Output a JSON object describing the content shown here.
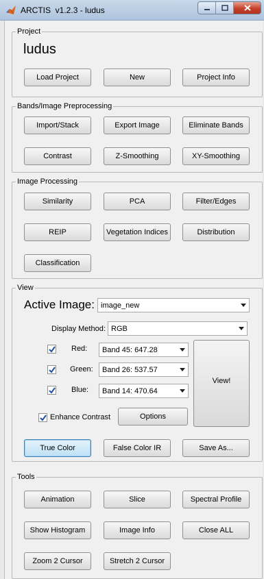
{
  "window": {
    "title": "ARCTIS  v1.2.3 - ludus",
    "controls": [
      "minimize",
      "maximize",
      "close"
    ]
  },
  "project": {
    "group_title": "Project",
    "name": "ludus",
    "buttons": [
      "Load Project",
      "New",
      "Project Info"
    ]
  },
  "bands": {
    "group_title": "Bands/Image Preprocessing",
    "buttons": [
      "Import/Stack",
      "Export Image",
      "Eliminate Bands",
      "Contrast",
      "Z-Smoothing",
      "XY-Smoothing"
    ]
  },
  "image_processing": {
    "group_title": "Image Processing",
    "buttons": [
      "Similarity",
      "PCA",
      "Filter/Edges",
      "REIP",
      "Vegetation Indices",
      "Distribution",
      "Classification"
    ]
  },
  "view": {
    "group_title": "View",
    "active_image_label": "Active Image:",
    "active_image_value": "image_new",
    "display_method_label": "Display Method:",
    "display_method_value": "RGB",
    "channels": [
      {
        "label": "Red:",
        "checked": true,
        "value": "Band 45: 647.28"
      },
      {
        "label": "Green:",
        "checked": true,
        "value": "Band 26: 537.57"
      },
      {
        "label": "Blue:",
        "checked": true,
        "value": "Band 14: 470.64"
      }
    ],
    "view_button": "View!",
    "enhance_contrast_label": "Enhance Contrast",
    "enhance_contrast_checked": true,
    "options_button": "Options",
    "true_color_button": "True Color",
    "false_color_button": "False Color IR",
    "save_as_button": "Save As..."
  },
  "tools": {
    "group_title": "Tools",
    "buttons": [
      "Animation",
      "Slice",
      "Spectral Profile",
      "Show Histogram",
      "Image Info",
      "Close ALL",
      "Zoom 2 Cursor",
      "Stretch 2 Cursor"
    ]
  },
  "colors": {
    "accent": "#3c7fb1",
    "check": "#1f4f9c"
  }
}
